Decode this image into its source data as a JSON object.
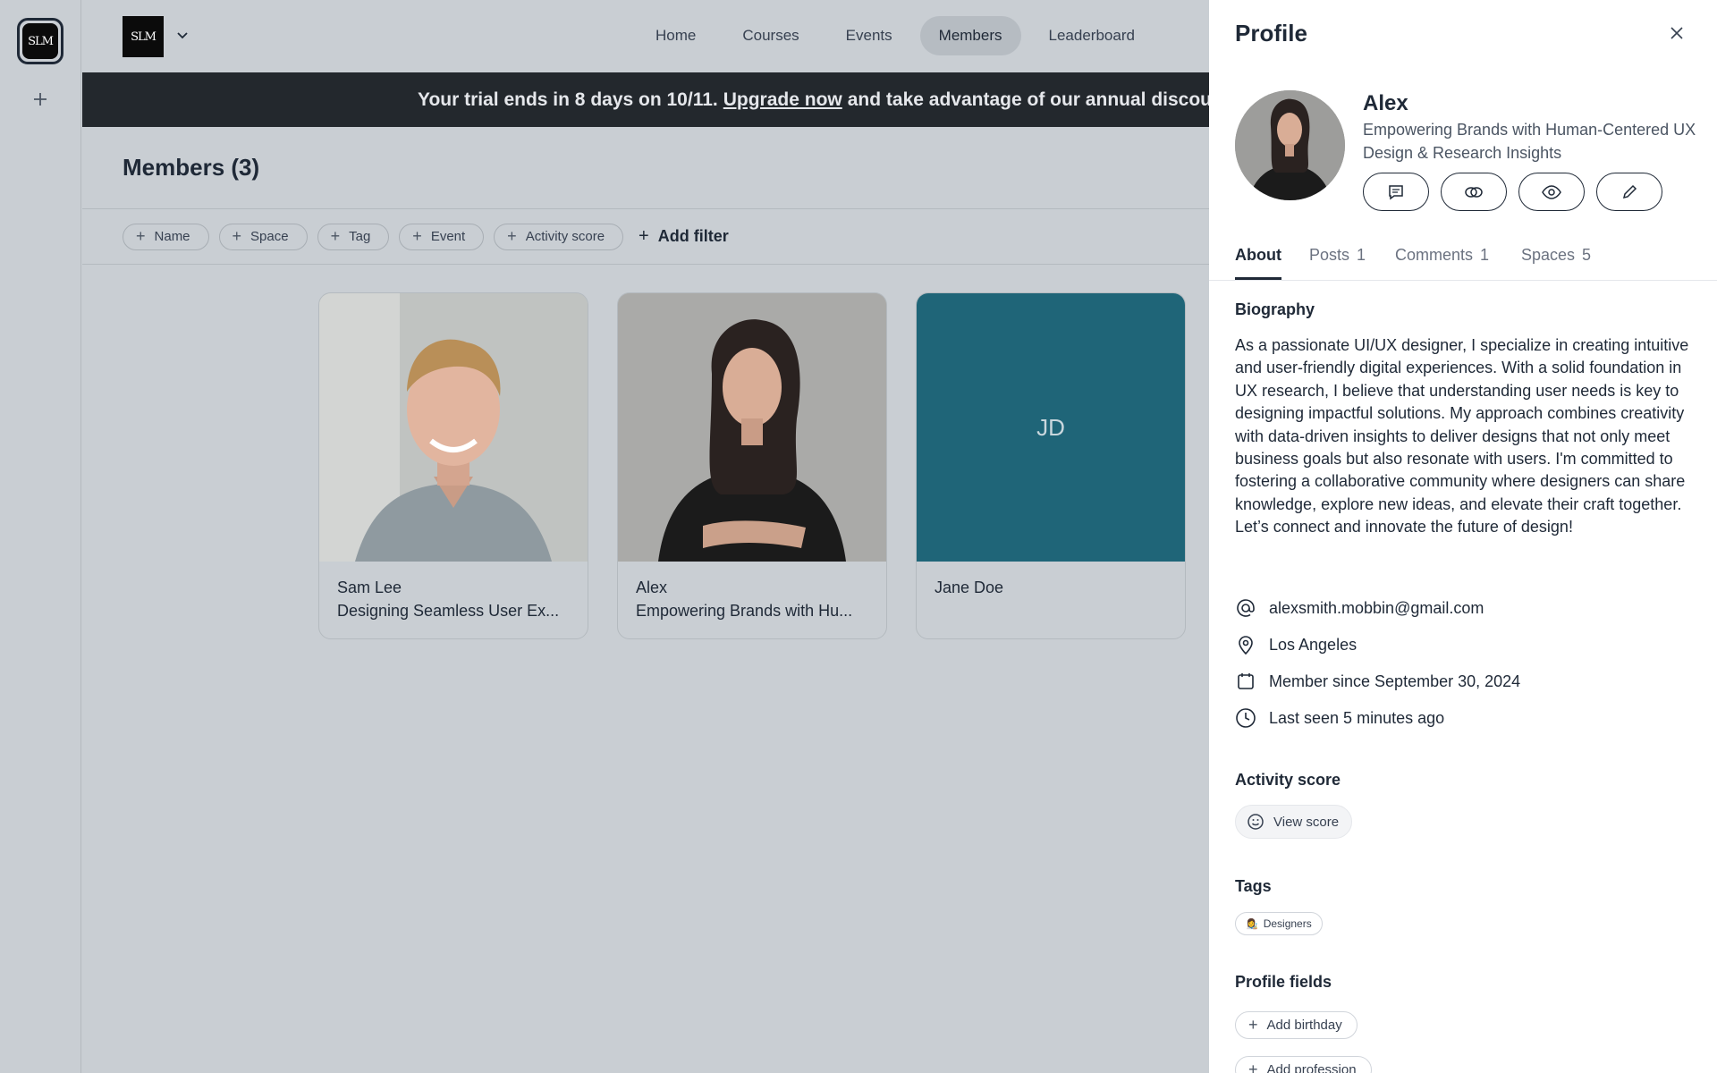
{
  "rail": {
    "logo_text": "SLM",
    "add_icon": "plus-icon"
  },
  "topbar": {
    "brand_text": "SLM",
    "nav": [
      {
        "label": "Home",
        "active": false
      },
      {
        "label": "Courses",
        "active": false
      },
      {
        "label": "Events",
        "active": false
      },
      {
        "label": "Members",
        "active": true
      },
      {
        "label": "Leaderboard",
        "active": false
      }
    ]
  },
  "banner": {
    "text_before": "Your trial ends in 8 days on 10/11.",
    "link": "Upgrade now",
    "text_after": "and take advantage of our annual discounts"
  },
  "members": {
    "title": "Members (3)",
    "filters": [
      "Name",
      "Space",
      "Tag",
      "Event",
      "Activity score"
    ],
    "add_filter": "Add filter",
    "cards": [
      {
        "name": "Sam Lee",
        "headline": "Designing Seamless User Ex..."
      },
      {
        "name": "Alex",
        "headline": "Empowering Brands with Hu..."
      },
      {
        "name": "Jane Doe",
        "headline": "",
        "initials": "JD"
      }
    ]
  },
  "profile": {
    "title": "Profile",
    "name": "Alex",
    "headline": "Empowering Brands with Human-Centered UX Design & Research Insights",
    "tabs": [
      {
        "label": "About",
        "count": "",
        "active": true
      },
      {
        "label": "Posts",
        "count": "1",
        "active": false
      },
      {
        "label": "Comments",
        "count": "1",
        "active": false
      },
      {
        "label": "Spaces",
        "count": "5",
        "active": false
      }
    ],
    "biography_heading": "Biography",
    "biography": "As a passionate UI/UX designer, I specialize in creating intuitive and user-friendly digital experiences. With a solid foundation in UX research, I believe that understanding user needs is key to designing impactful solutions. My approach combines creativity with data-driven insights to deliver designs that not only meet business goals but also resonate with users. I'm committed to fostering a collaborative community where designers can share knowledge, explore new ideas, and elevate their craft together. Let’s connect and innovate the future of design!",
    "email": "alexsmith.mobbin@gmail.com",
    "location": "Los Angeles",
    "member_since": "Member since September 30, 2024",
    "last_seen": "Last seen 5 minutes ago",
    "activity_heading": "Activity score",
    "view_score": "View score",
    "tags_heading": "Tags",
    "tag": "Designers",
    "profile_fields_heading": "Profile fields",
    "add_birthday": "Add birthday",
    "add_profession": "Add profession"
  }
}
